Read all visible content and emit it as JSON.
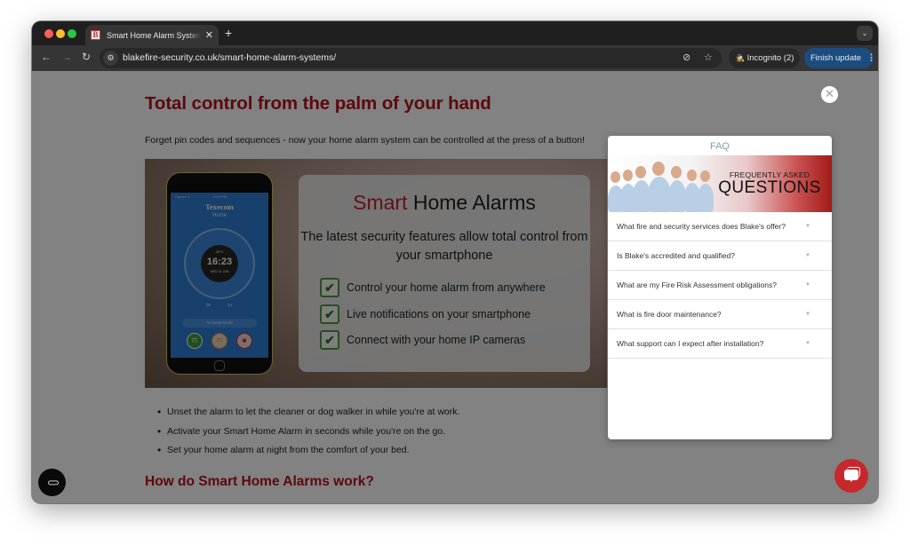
{
  "browser": {
    "tab": {
      "title": "Smart Home Alarm Systems | Blake Fire & Security",
      "favicon_letter": "B"
    },
    "new_tab_icon": "+",
    "url": "blakefire-security.co.uk/smart-home-alarm-systems/",
    "incognito_label": "Incognito (2)",
    "finish_update_label": "Finish update",
    "icons": {
      "back": "←",
      "forward": "→",
      "reload": "↻",
      "site_info": "⚙",
      "eye_off": "⊘",
      "star": "☆",
      "incognito": "🕵",
      "more": "⋮",
      "tab_menu": "⌄",
      "close": "✕"
    }
  },
  "page": {
    "heading": "Total control from the palm of your hand",
    "intro": "Forget pin codes and sequences - now your home alarm system can be controlled at the press of a button!",
    "hero": {
      "phone": {
        "status_left": "Carrier ᯤ",
        "status_time": "4:23 PM",
        "brand": "Texecom",
        "screen_title": "Home",
        "temperature": "26°C",
        "time": "16:23",
        "date": "WED 21 JUN",
        "tick_start": "00",
        "tick_end": "24",
        "mode": "At Home Mode"
      },
      "promo_title_accent": "Smart",
      "promo_title_rest": " Home Alarms",
      "promo_subtitle": "The latest security features allow total control from your smartphone",
      "features": [
        "Control your home alarm from anywhere",
        "Live notifications on your smartphone",
        "Connect with your home IP cameras"
      ],
      "check_icon": "✔"
    },
    "bullets": [
      "Unset the alarm to let the cleaner or dog walker in while you're at work.",
      "Activate your Smart Home Alarm in seconds while you're on the go.",
      "Set your home alarm at night from the comfort of your bed."
    ],
    "subheading": "How do Smart Home Alarms work?"
  },
  "faq": {
    "header": "FAQ",
    "banner_small": "FREQUENTLY ASKED",
    "banner_big": "QUESTIONS",
    "caret": "▼",
    "questions": [
      "What fire and security services does Blake's offer?",
      "Is Blake's accredited and qualified?",
      "What are my Fire Risk Assessment obligations?",
      "What is fire door maintenance?",
      "What support can I expect after installation?"
    ]
  },
  "floating": {
    "accessibility_icon": "⊂⊃"
  },
  "colors": {
    "brand_red": "#b5121b",
    "accent_blue": "#1d4d7e",
    "chat_red": "#c7282b"
  }
}
